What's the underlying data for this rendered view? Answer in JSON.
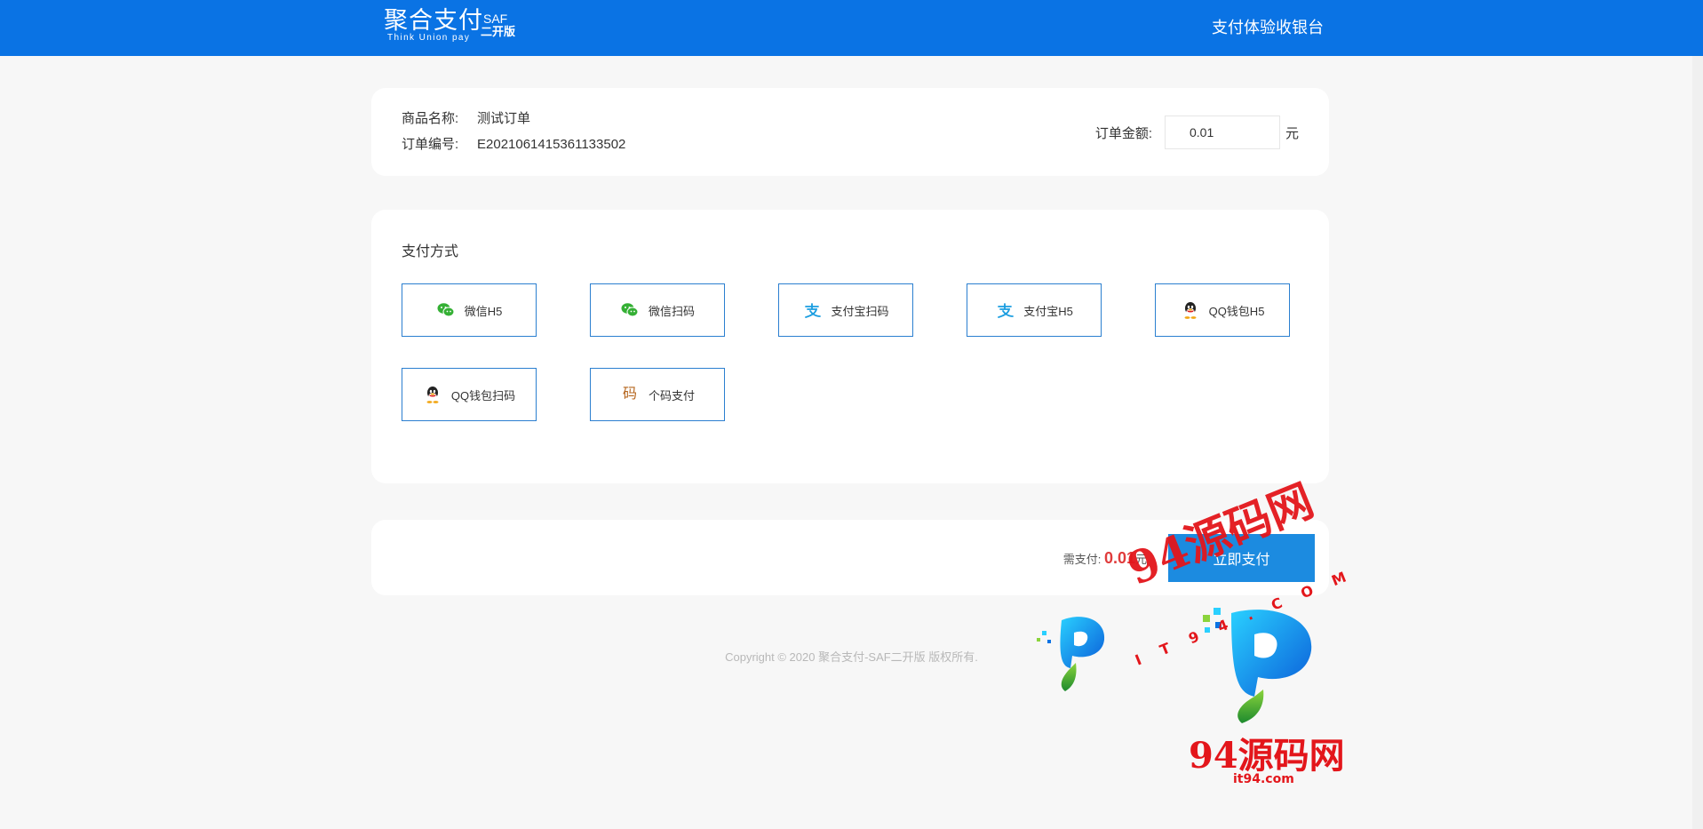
{
  "header": {
    "logo": {
      "main": "聚合支付",
      "sub": "Think Union pay",
      "badge_top": "SAF",
      "badge_bottom": "二开版"
    },
    "title": "支付体验收银台",
    "color": "#0a73e4"
  },
  "order": {
    "name_label": "商品名称:",
    "name_value": "测试订单",
    "no_label": "订单编号:",
    "no_value": "E2021061415361133502",
    "amount_label": "订单金额:",
    "amount_value": "0.01",
    "amount_unit": "元"
  },
  "methods": {
    "title": "支付方式",
    "items": [
      {
        "label": "微信H5",
        "icon": "wechat-icon"
      },
      {
        "label": "微信扫码",
        "icon": "wechat-icon"
      },
      {
        "label": "支付宝扫码",
        "icon": "alipay-icon"
      },
      {
        "label": "支付宝H5",
        "icon": "alipay-icon"
      },
      {
        "label": "QQ钱包H5",
        "icon": "qq-icon"
      },
      {
        "label": "QQ钱包扫码",
        "icon": "qq-icon"
      },
      {
        "label": "个码支付",
        "icon": "code-icon"
      }
    ],
    "code_icon_glyph": "码"
  },
  "pay": {
    "label": "需支付:",
    "amount": "0.01",
    "unit": "元",
    "button": "立即支付"
  },
  "footer": {
    "copyright": "Copyright © 2020 聚合支付-SAF二开版 版权所有."
  },
  "watermark": {
    "text1": "94源码网",
    "text1_sub": "IT94.COM",
    "text2": "94源码网",
    "text2_sub": "it94.com"
  }
}
